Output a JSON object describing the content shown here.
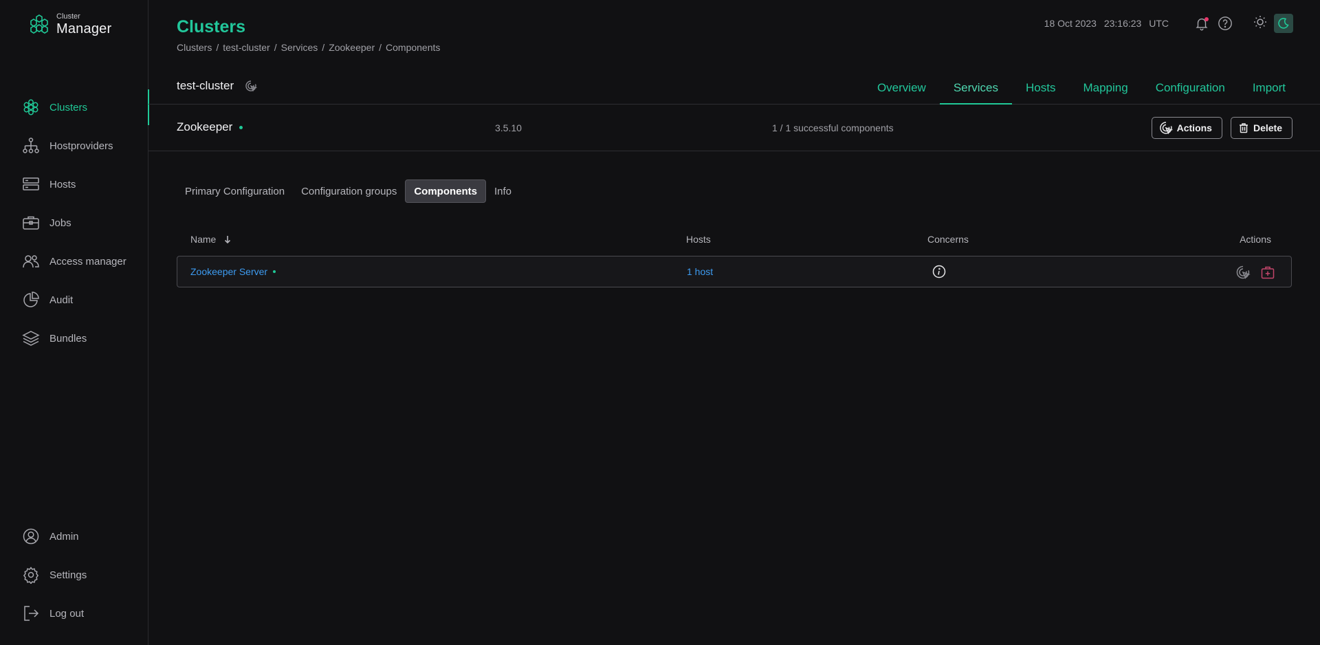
{
  "logo": {
    "small": "Cluster",
    "big": "Manager"
  },
  "sidebar": {
    "items": [
      {
        "label": "Clusters",
        "icon": "clusters-icon",
        "active": true
      },
      {
        "label": "Hostproviders",
        "icon": "hostproviders-icon"
      },
      {
        "label": "Hosts",
        "icon": "hosts-icon"
      },
      {
        "label": "Jobs",
        "icon": "jobs-icon"
      },
      {
        "label": "Access manager",
        "icon": "access-manager-icon"
      },
      {
        "label": "Audit",
        "icon": "audit-icon"
      },
      {
        "label": "Bundles",
        "icon": "bundles-icon"
      }
    ],
    "bottom": [
      {
        "label": "Admin",
        "icon": "admin-icon"
      },
      {
        "label": "Settings",
        "icon": "gear-icon"
      },
      {
        "label": "Log out",
        "icon": "logout-icon"
      }
    ]
  },
  "header": {
    "title": "Clusters",
    "breadcrumb": [
      "Clusters",
      "test-cluster",
      "Services",
      "Zookeeper",
      "Components"
    ],
    "breadcrumb_sep": "/",
    "date": "18 Oct 2023",
    "time": "23:16:23",
    "timezone": "UTC"
  },
  "cluster": {
    "name": "test-cluster",
    "tabs": [
      "Overview",
      "Services",
      "Hosts",
      "Mapping",
      "Configuration",
      "Import"
    ],
    "active_tab": "Services"
  },
  "service": {
    "name": "Zookeeper",
    "version": "3.5.10",
    "concerns_summary": "1 / 1 successful components",
    "actions_label": "Actions",
    "delete_label": "Delete"
  },
  "subtabs": [
    "Primary Configuration",
    "Configuration groups",
    "Components",
    "Info"
  ],
  "active_subtab": "Components",
  "table": {
    "columns": {
      "name": "Name",
      "hosts": "Hosts",
      "concerns": "Concerns",
      "actions": "Actions"
    },
    "rows": [
      {
        "name": "Zookeeper Server",
        "hosts": "1 host"
      }
    ]
  },
  "colors": {
    "accent": "#20c997",
    "link": "#3d9bf0",
    "alert_dot": "#e8366a",
    "danger_icon": "#c2456a"
  }
}
